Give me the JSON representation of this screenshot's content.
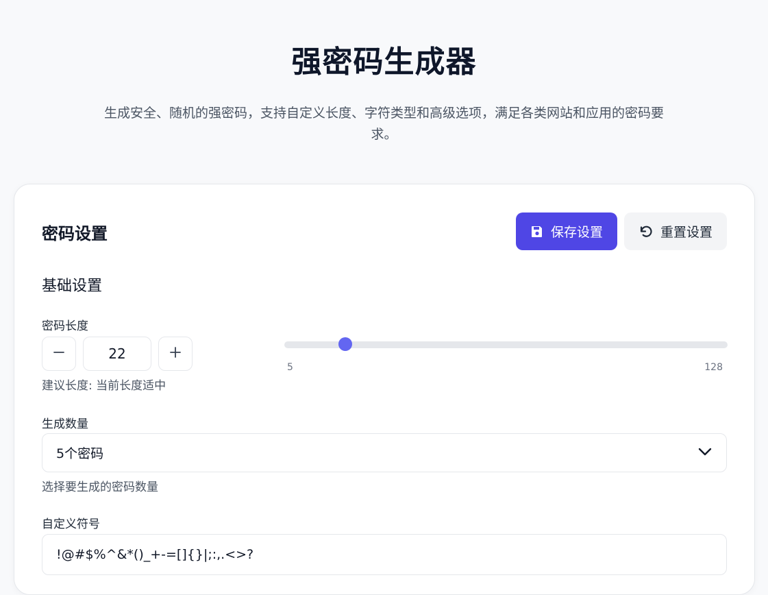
{
  "header": {
    "title": "强密码生成器",
    "subtitle": "生成安全、随机的强密码，支持自定义长度、字符类型和高级选项，满足各类网站和应用的密码要求。"
  },
  "card": {
    "title": "密码设置",
    "save_label": "保存设置",
    "reset_label": "重置设置",
    "section_basic": "基础设置",
    "length": {
      "label": "密码长度",
      "value": "22",
      "min": 5,
      "max": 128,
      "min_label": "5",
      "max_label": "128",
      "hint": "建议长度: 当前长度适中"
    },
    "count": {
      "label": "生成数量",
      "selected": "5个密码",
      "hint": "选择要生成的密码数量"
    },
    "symbols": {
      "label": "自定义符号",
      "value": "!@#$%^&*()_+-=[]{}|;:,.<>?"
    }
  },
  "colors": {
    "accent": "#4f46e5",
    "slider": "#6366f1"
  },
  "icons": {
    "save": "save-icon",
    "reset": "reset-icon",
    "minus": "minus-icon",
    "plus": "plus-icon",
    "dropdown": "chevron-down-icon"
  }
}
